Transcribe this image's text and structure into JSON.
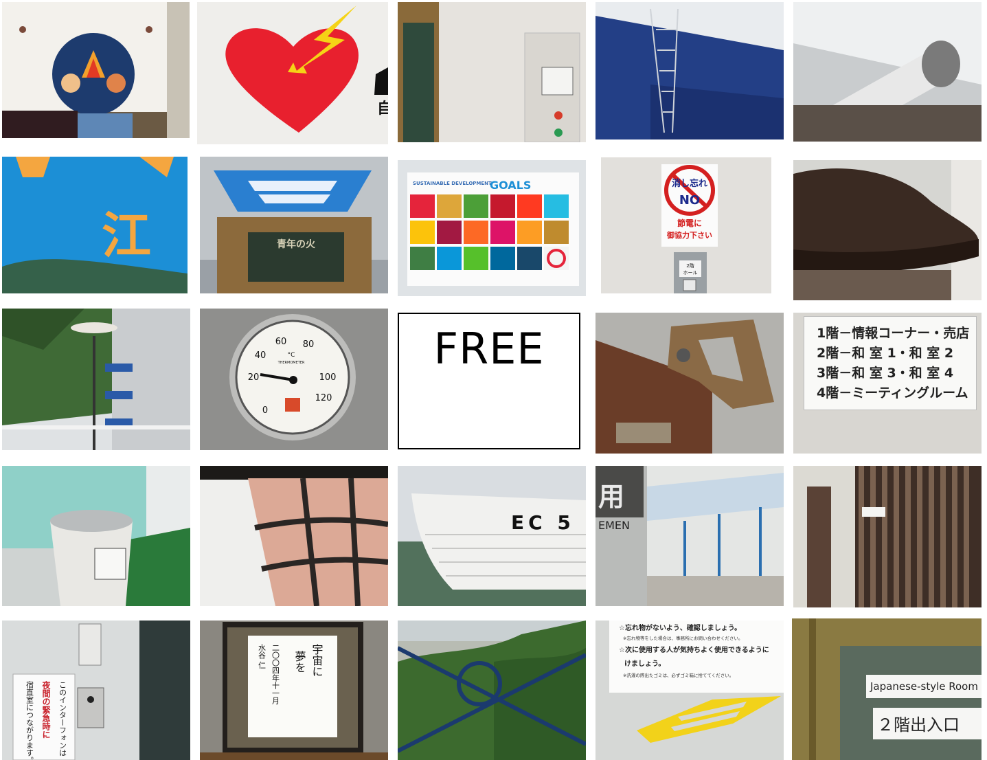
{
  "grid": {
    "rows": [
      {
        "tiles": [
          {
            "id": "mascot-sign"
          },
          {
            "id": "heart-lightning"
          },
          {
            "id": "wall-panel-meter",
            "text": "自"
          },
          {
            "id": "blue-building-ladder"
          },
          {
            "id": "ceiling-vent-pipe"
          }
        ]
      },
      {
        "tiles": [
          {
            "id": "blue-sign-closeup",
            "text": "江"
          },
          {
            "id": "youth-fire-monument",
            "plaque_title": "青年の火"
          },
          {
            "id": "sdgs-poster",
            "title_small": "SUSTAINABLE DEVELOPMENT",
            "title_big": "GOALS"
          },
          {
            "id": "switch-off-sign",
            "line1": "消し忘れ",
            "line2": "NO",
            "line3": "節電に",
            "line4": "御協力下さい",
            "switch_label_1": "2階",
            "switch_label_2": "ホール"
          },
          {
            "id": "boot-sculpture"
          }
        ]
      },
      {
        "tiles": [
          {
            "id": "building-lamp-post"
          },
          {
            "id": "thermometer-dial",
            "ticks": [
              "0",
              "20",
              "40",
              "60",
              "80",
              "100",
              "120"
            ],
            "unit": "°C",
            "brand": "THERMOMETER"
          },
          {
            "id": "free-square",
            "label": "FREE"
          },
          {
            "id": "rusty-saw-handle"
          },
          {
            "id": "floor-directory",
            "lines": [
              "1階－情報コーナー・売店",
              "2階－和 室 1・和 室 2",
              "3階－和 室 3・和 室 4",
              "4階－ミーティングルーム"
            ]
          }
        ]
      },
      {
        "tiles": [
          {
            "id": "drinking-fountain"
          },
          {
            "id": "arched-window-grid"
          },
          {
            "id": "boat-hull",
            "label": "EC 5"
          },
          {
            "id": "covered-walkway",
            "sign_fragment": "用",
            "sign_fragment_2": "EMEN"
          },
          {
            "id": "wood-slat-hallway"
          }
        ]
      },
      {
        "tiles": [
          {
            "id": "intercom-notice",
            "col1": "このインターフォンは",
            "col2": "夜間の緊急時に",
            "col3": "宿直室につながります。"
          },
          {
            "id": "framed-calligraphy",
            "col1": "宇宙に",
            "col2": "夢を",
            "col3": "二〇〇四年十一月",
            "col4": "水谷 仁"
          },
          {
            "id": "ring-railing-view"
          },
          {
            "id": "lost-items-notice",
            "line1": "☆忘れ物がないよう、確認しましょう。",
            "line2": "※忘れ物等をした場合は、事務所にお問い合わせください。",
            "line3": "☆次に使用する人が気持ちよく使用できるように",
            "line4": "けましょう。",
            "line5": "※洗濯の際出たゴミは、必ずゴミ箱に捨ててください。"
          },
          {
            "id": "room-door-sign",
            "line1": "Japanese-style Room",
            "line2": "２階出入口"
          }
        ]
      }
    ]
  },
  "colors": {
    "heart": "#e8202e",
    "bolt": "#f5d316",
    "building_blue": "#233f86",
    "sign_blue": "#1c8fd6",
    "monument_blue": "#2a7fd0",
    "stop_red": "#d42020",
    "yellow_arrow": "#f2d21a"
  }
}
